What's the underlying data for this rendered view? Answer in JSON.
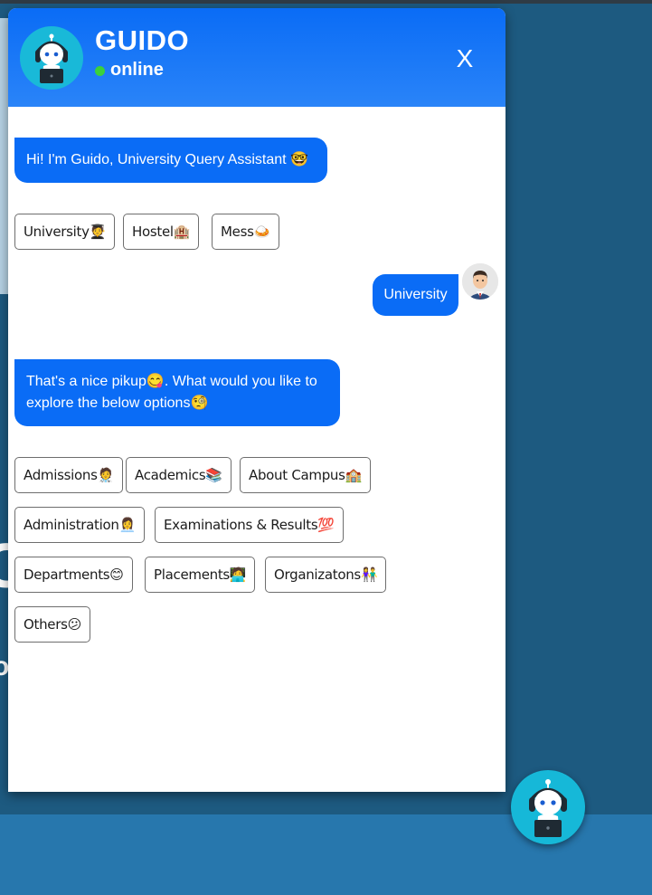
{
  "header": {
    "bot_name": "GUIDO",
    "status": "online"
  },
  "messages": {
    "greeting": "Hi! I'm Guido, University Query Assistant 🤓",
    "user_reply": "University",
    "followup": "That's a nice pikup😋. What would you like to explore the below options🧐"
  },
  "chips_first": [
    "University🧑‍🎓",
    "Hostel🏨",
    "Mess🍛"
  ],
  "chips_second": [
    "Admissions🧑‍⚕️",
    "Academics📚",
    "About Campus🏫",
    "Administration👩‍💼",
    "Examinations & Results💯",
    "Departments😊",
    "Placements🧑‍💻",
    "Organizatons👫",
    "Others😕"
  ],
  "close_label": "X",
  "colors": {
    "accent": "#0a6cf6",
    "status": "#3bd13b",
    "page_bg": "#1d5a80"
  }
}
